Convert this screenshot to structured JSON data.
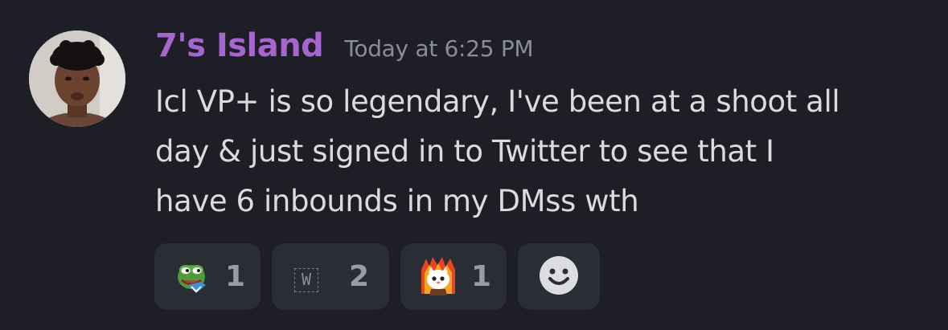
{
  "message": {
    "author": "7's Island",
    "timestamp": "Today at 6:25 PM",
    "content_lines": [
      "Icl VP+ is so legendary, I've been at a shoot all",
      "day & just signed in to Twitter to see that I",
      "have 6 inbounds in my DMss wth"
    ]
  },
  "reactions": [
    {
      "emoji": "pepe-happy-icon",
      "count": "1"
    },
    {
      "emoji": "w-emoji-icon",
      "label": "W",
      "count": "2"
    },
    {
      "emoji": "fire-cat-icon",
      "count": "1"
    }
  ],
  "add_reaction": {
    "icon": "smiley-add-reaction-icon"
  },
  "colors": {
    "background": "#1e1f26",
    "username": "#a765cf",
    "timestamp": "#8b8d96",
    "text": "#d9dbe0",
    "reaction_bg": "#2b2d35",
    "reaction_count": "#9a9ca5"
  }
}
